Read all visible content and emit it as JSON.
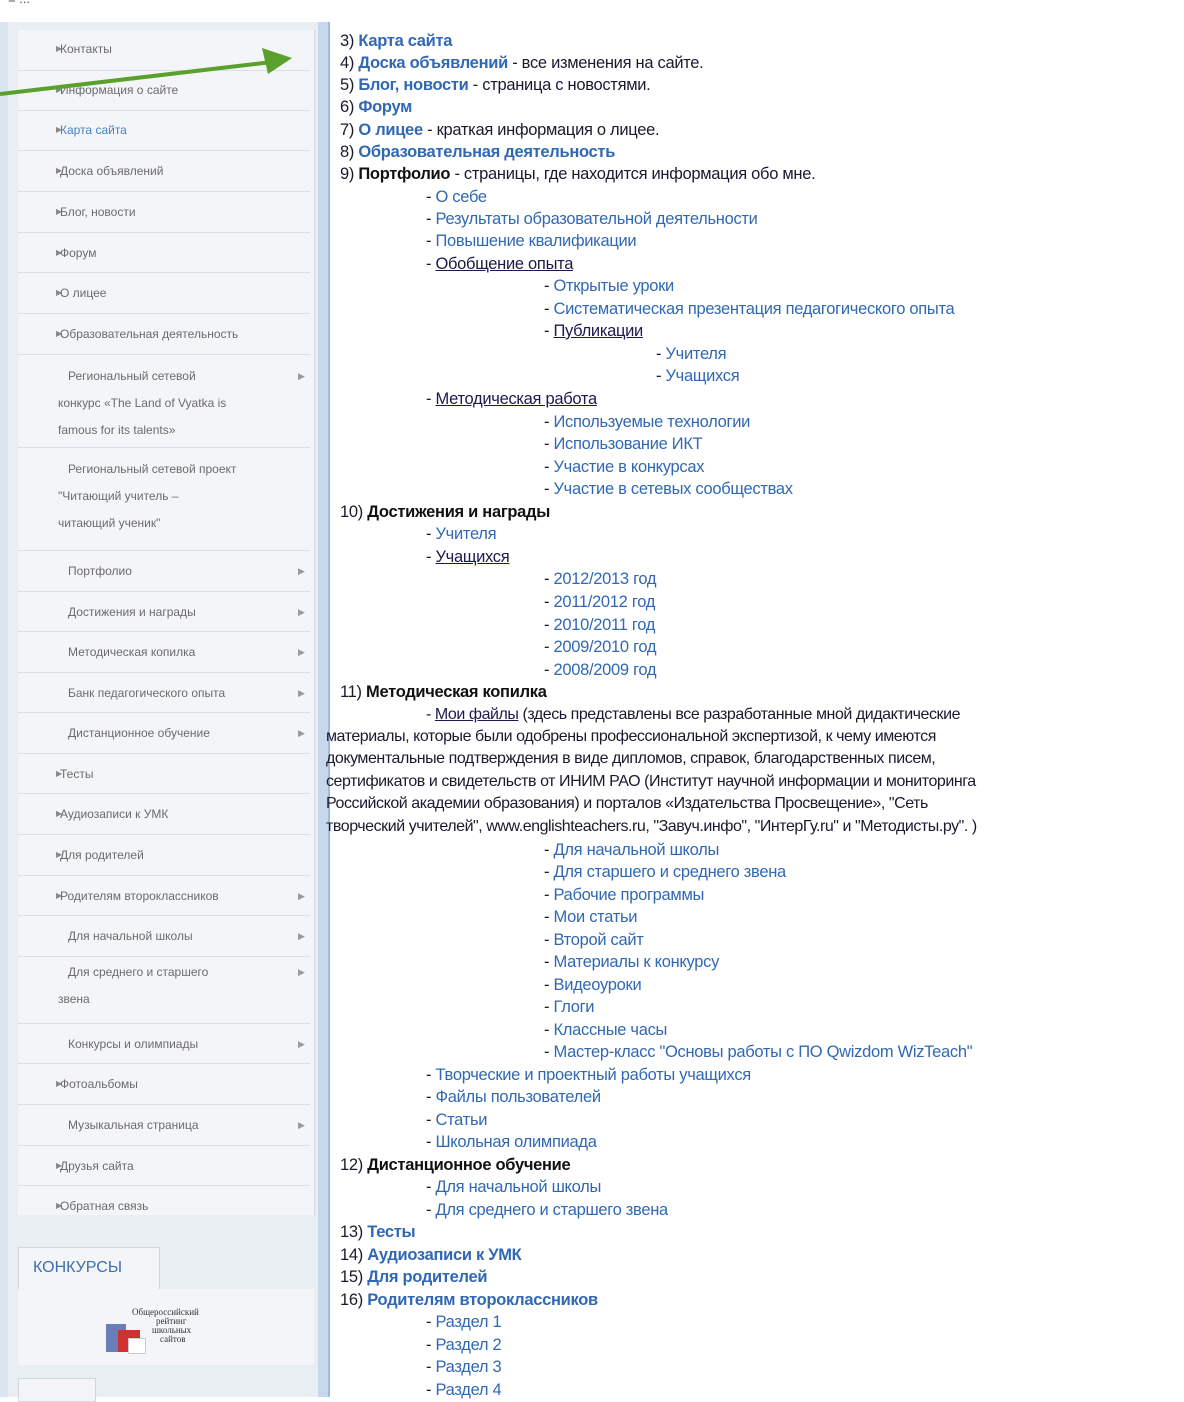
{
  "top_bar": {
    "text": "≡ ..."
  },
  "sidebar": {
    "menu": [
      {
        "label": "Контакты",
        "marker": "▶"
      },
      {
        "label": "Информация о сайте",
        "marker": "▶"
      },
      {
        "label": "Карта сайта",
        "marker": "▶"
      },
      {
        "label": "Доска объявлений",
        "marker": "▶"
      },
      {
        "label": "Блог, новости",
        "marker": "▶"
      },
      {
        "label": "Форум",
        "marker": "▶"
      },
      {
        "label": "О лицее",
        "marker": "▶"
      },
      {
        "label": "Образовательная деятельность",
        "marker": "▶"
      },
      {
        "lines": [
          "Региональный сетевой",
          "конкурс «The Land of Vyatka is",
          "famous for its talents»"
        ],
        "arrow": "▶"
      },
      {
        "lines": [
          "Региональный сетевой проект",
          "\"Читающий учитель –",
          "читающий ученик\""
        ],
        "arrow": "▶"
      },
      {
        "label": "Портфолио",
        "arrow": "▶"
      },
      {
        "label": "Достижения и награды",
        "arrow": "▶"
      },
      {
        "label": "Методическая копилка",
        "arrow": "▶"
      },
      {
        "label": "Банк педагогического опыта",
        "arrow": "▶"
      },
      {
        "label": "Дистанционное обучение",
        "arrow": "▶"
      },
      {
        "label": "Тесты",
        "marker": "▶"
      },
      {
        "label": "Аудиозаписи к УМК",
        "marker": "▶"
      },
      {
        "label": "Для родителей",
        "marker": "▶"
      },
      {
        "label": "Родителям второклассников",
        "marker": "▶",
        "arrow": "▶"
      },
      {
        "label": "Для начальной школы",
        "arrow": "▶"
      },
      {
        "lines": [
          "Для среднего и старшего",
          "звена"
        ],
        "arrow": "▶"
      },
      {
        "label": "Конкурсы и олимпиады",
        "arrow": "▶"
      },
      {
        "label": "Фотоальбомы",
        "marker": "▶"
      },
      {
        "label": "Музыкальная страница",
        "arrow": "▶"
      },
      {
        "label": "Друзья сайта",
        "marker": "▶"
      },
      {
        "label": "Обратная связь",
        "marker": "▶"
      }
    ],
    "konkursy_tab": "КОНКУРСЫ",
    "logo_text": [
      "Общероссийский",
      "рейтинг",
      "школьных",
      "сайтов"
    ]
  },
  "sitemap": {
    "l3_num": "3)",
    "l3_link": "Карта сайта",
    "l4_num": "4)",
    "l4_link": "Доска объявлений",
    "l4_desc": " - все изменения на сайте.",
    "l5_num": "5)",
    "l5_link": "Блог, новости",
    "l5_desc": " - страница с новостями.",
    "l6_num": "6)",
    "l6_link": "Форум",
    "l7_num": "7)",
    "l7_link": "О лицее",
    "l7_desc": " - краткая информация о лицее.",
    "l8_num": "8)",
    "l8_link": "Образовательная деятельность",
    "l9_num": "9)",
    "l9_bold": "Портфолио",
    "l9_desc": " - страницы, где находится информация обо мне.",
    "p_about": "О себе",
    "p_results": "Результаты образовательной деятельности",
    "p_qual": "Повышение квалификации",
    "p_general": "Обобщение опыта",
    "p_open": "Открытые уроки",
    "p_system": "Систематическая презентация педагогического опыта",
    "p_pub": "Публикации",
    "p_pub_t": "Учителя",
    "p_pub_s": "Учащихся",
    "p_method": "Методическая работа",
    "p_tech": "Используемые технологии",
    "p_ikt": "Использование ИКТ",
    "p_contest": "Участие в конкурсах",
    "p_net": "Участие в сетевых сообществах",
    "l10_num": "10)",
    "l10_bold": "Достижения и награды",
    "a_teacher": "Учителя",
    "a_students": "Учащихся",
    "y1": "2012/2013 год",
    "y2": "2011/2012 год",
    "y3": "2010/2011 год",
    "y4": "2009/2010 год",
    "y5": "2008/2009 год",
    "l11_num": "11)",
    "l11_bold": "Методическая копилка",
    "files_link": "Мои файлы",
    "files_line1": " (здесь представлены все разработанные мной дидактические",
    "files_line2": "материалы, которые были  одобрены профессиональной экспертизой, к чему имеются",
    "files_line3": "документальные подтверждения в виде дипломов, справок, благодарственных писем,",
    "files_line4": "сертификатов и свидетельств от ИНИМ РАО (Институт научной информации и мониторинга",
    "files_line5": "Российской академии образования)  и порталов «Издательства Просвещение», \"Сеть",
    "files_line6": "творческий учителей\", www.englishteachers.ru, \"Завуч.инфо\", \"ИнтерГу.ru\" и \"Методисты.ру\". )",
    "f1": "Для начальной школы",
    "f2": "Для старшего и среднего звена",
    "f3": "Рабочие программы",
    "f4": "Мои статьи",
    "f5": "Второй сайт",
    "f6": "Материалы к конкурсу",
    "f7": "Видеоуроки",
    "f8": "Глоги",
    "f9": "Классные часы",
    "f10": "Мастер-класс \"Основы работы с ПО Qwizdom WizTeach\"",
    "m1": "Творческие и проектный работы учащихся",
    "m2": "Файлы пользователей",
    "m3": "Статьи",
    "m4": "Школьная олимпиада",
    "l12_num": "12)",
    "l12_bold": "Дистанционное обучение",
    "d1": "Для начальной школы",
    "d2": "Для среднего и старшего звена",
    "l13_num": "13)",
    "l13_link": "Тесты",
    "l14_num": "14)",
    "l14_link": "Аудиозаписи к УМК",
    "l15_num": "15)",
    "l15_link": "Для родителей",
    "l16_num": "16)",
    "l16_link": "Родителям второклассников",
    "r1": "Раздел 1",
    "r2": "Раздел 2",
    "r3": "Раздел 3",
    "r4": "Раздел 4",
    "dash": "- "
  },
  "colors": {
    "link": "#3168b3",
    "arrow": "#5aa02c",
    "sidebar_bg": "#e9eef3"
  }
}
